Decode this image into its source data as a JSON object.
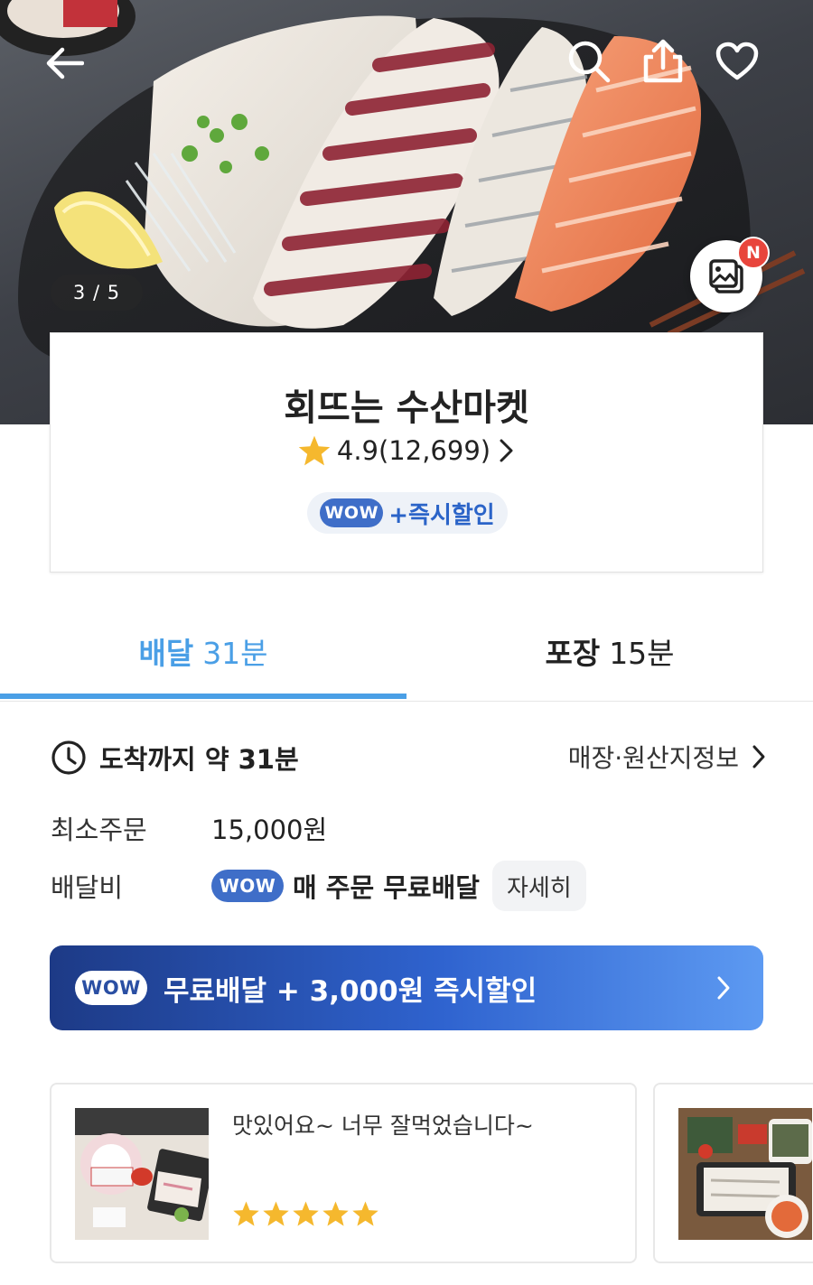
{
  "hero": {
    "image_counter": "3 / 5",
    "new_badge": "N",
    "icons": [
      "back-arrow-icon",
      "search-icon",
      "share-icon",
      "heart-icon",
      "photo-review-icon"
    ]
  },
  "store": {
    "name": "회뜨는 수산마켓",
    "rating": "4.9(12,699)",
    "wow_label": "WOW",
    "chip_text": "+즉시할인"
  },
  "tabs": [
    {
      "label": "배달",
      "time": "31분",
      "active": true
    },
    {
      "label": "포장",
      "time": "15분",
      "active": false
    }
  ],
  "delivery": {
    "arrival_text": "도착까지 약 31분",
    "store_info_link": "매장·원산지정보",
    "min_order_label": "최소주문",
    "min_order_value": "15,000원",
    "fee_label": "배달비",
    "fee_wow": "WOW",
    "fee_text": "매 주문 무료배달",
    "detail_button": "자세히"
  },
  "banner": {
    "wow": "WOW",
    "text": "무료배달 + 3,000원 즉시할인"
  },
  "reviews": [
    {
      "text": "맛있어요~  너무 잘먹었습니다~",
      "stars": 5
    },
    {
      "text": "",
      "stars": 0
    }
  ],
  "colors": {
    "accent_blue": "#4a9fe6",
    "wow_blue": "#3f6ec8",
    "star_yellow": "#f5b82e",
    "badge_red": "#e8453c"
  }
}
